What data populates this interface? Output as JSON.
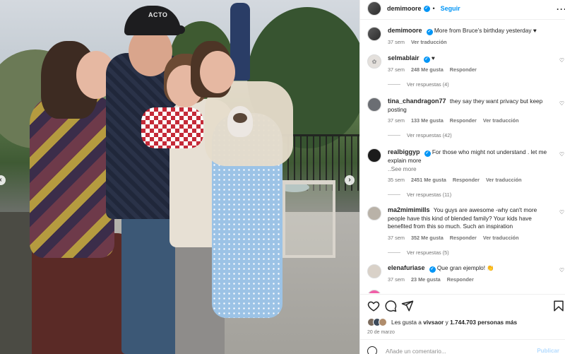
{
  "post": {
    "author": "demimoore",
    "follow_label": "Seguir",
    "more_icon": "more-horizontal-icon"
  },
  "caption": {
    "user": "demimoore",
    "text": "More from Bruce’s birthday yesterday ♥",
    "time": "37 sem",
    "translate": "Ver traducción"
  },
  "comments": [
    {
      "user": "selmablair",
      "verified": true,
      "text": "♥",
      "time": "37 sem",
      "likes": "248 Me gusta",
      "reply": "Responder",
      "translate": "",
      "replies": "Ver respuestas (4)"
    },
    {
      "user": "tina_chandragon77",
      "verified": false,
      "text": "they say they want privacy but keep posting",
      "time": "37 sem",
      "likes": "133 Me gusta",
      "reply": "Responder",
      "translate": "Ver traducción",
      "replies": "Ver respuestas (42)"
    },
    {
      "user": "realbiggyp",
      "verified": true,
      "text": "For those who might not understand . let me explain more",
      "more": "..See more",
      "time": "35 sem",
      "likes": "2451 Me gusta",
      "reply": "Responder",
      "translate": "Ver traducción",
      "replies": "Ver respuestas (11)"
    },
    {
      "user": "ma2mimimills",
      "verified": false,
      "text": "You guys are awesome -why can't more people have this kind of blended family? Your kids have benefited from this so much. Such an inspiration",
      "time": "37 sem",
      "likes": "352 Me gusta",
      "reply": "Responder",
      "translate": "Ver traducción",
      "replies": "Ver respuestas (5)"
    },
    {
      "user": "elenafuriase",
      "verified": true,
      "text": "Que gran ejemplo! 👏",
      "time": "37 sem",
      "likes": "23 Me gusta",
      "reply": "Responder",
      "translate": "",
      "replies": ""
    }
  ],
  "actions": {
    "like_icon": "heart-icon",
    "comment_icon": "comment-icon",
    "share_icon": "share-icon",
    "save_icon": "bookmark-icon"
  },
  "likes": {
    "prefix": "Les gusta a",
    "user": "vivsaor",
    "middle": "y",
    "count": "1.744.703 personas más"
  },
  "date": "20 de marzo",
  "add_comment": {
    "placeholder": "Añade un comentario...",
    "publish": "Publicar"
  },
  "photo": {
    "cap_text": "ACTO"
  },
  "colors": {
    "accent": "#0095f6",
    "verified": "#0095f6",
    "text": "#262626",
    "muted": "#737373"
  }
}
